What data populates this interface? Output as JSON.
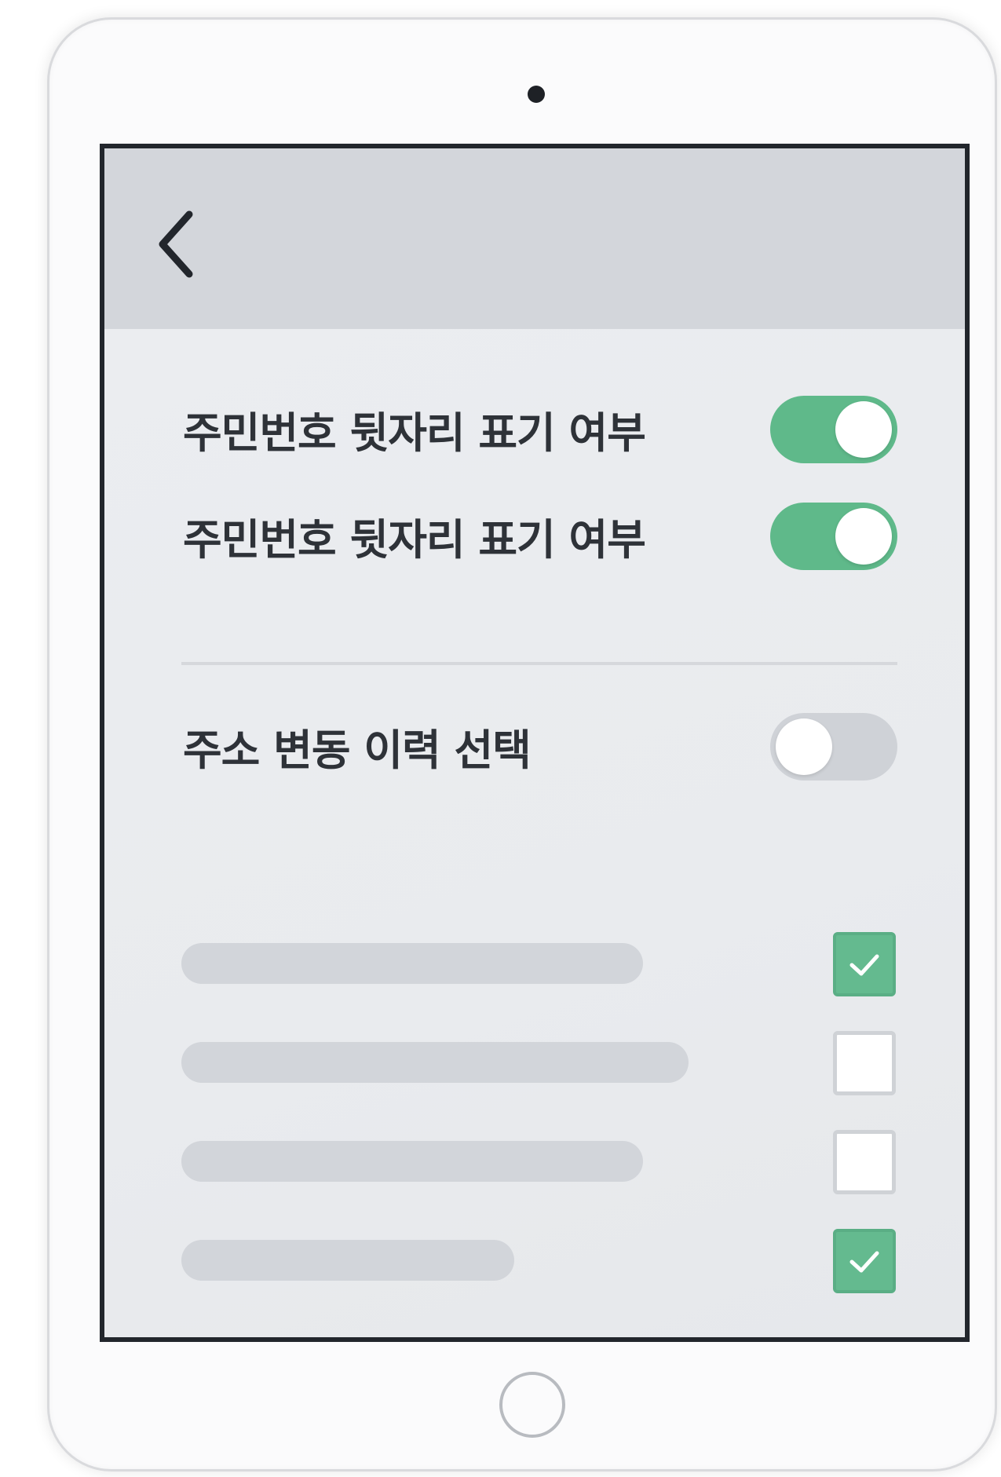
{
  "header": {
    "back_icon": "chevron-left-icon"
  },
  "settings": {
    "toggles": [
      {
        "label": "주민번호 뒷자리 표기 여부",
        "state": "on"
      },
      {
        "label": "주민번호 뒷자리 표기 여부",
        "state": "on"
      },
      {
        "label": "주소 변동 이력 선택",
        "state": "off"
      }
    ],
    "options": [
      {
        "checked": true
      },
      {
        "checked": false
      },
      {
        "checked": false
      },
      {
        "checked": true
      }
    ]
  },
  "colors": {
    "accent_green": "#5fb98a",
    "toggle_off": "#cfd2d7",
    "header_bg": "#d3d6db",
    "screen_bg": "#e8eaed"
  },
  "device": {
    "camera_icon": "camera-dot-icon",
    "home_icon": "home-button-icon"
  }
}
